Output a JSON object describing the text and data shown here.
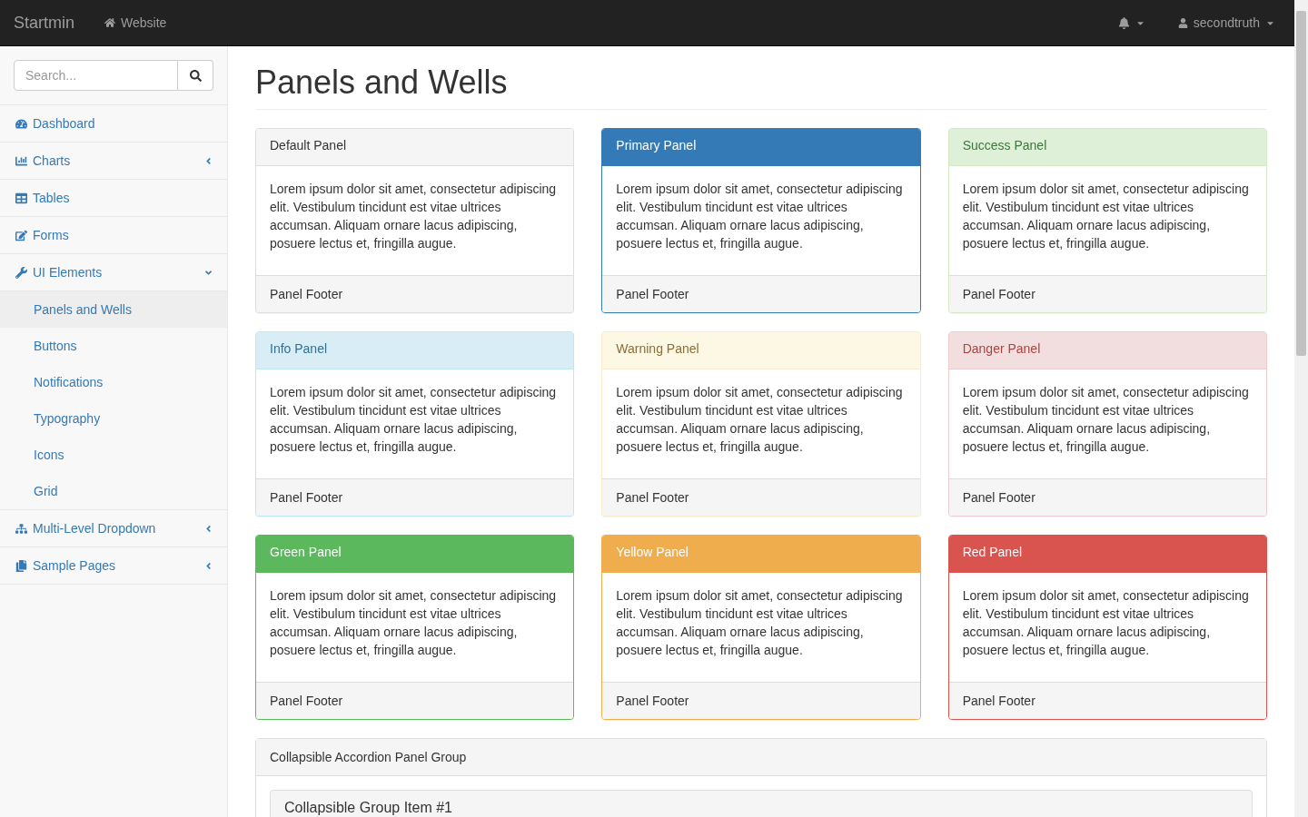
{
  "navbar": {
    "brand": "Startmin",
    "links": [
      {
        "label": "Website"
      }
    ],
    "user": "secondtruth"
  },
  "sidebar": {
    "search": {
      "placeholder": "Search..."
    },
    "items": [
      {
        "label": "Dashboard"
      },
      {
        "label": "Charts",
        "expanded": false
      },
      {
        "label": "Tables"
      },
      {
        "label": "Forms"
      },
      {
        "label": "UI Elements",
        "expanded": true,
        "children": [
          {
            "label": "Panels and Wells",
            "selected": true
          },
          {
            "label": "Buttons",
            "selected": false
          },
          {
            "label": "Notifications",
            "selected": false
          },
          {
            "label": "Typography",
            "selected": false
          },
          {
            "label": "Icons",
            "selected": false
          },
          {
            "label": "Grid",
            "selected": false
          }
        ]
      },
      {
        "label": "Multi-Level Dropdown",
        "expanded": false
      },
      {
        "label": "Sample Pages",
        "expanded": false
      }
    ]
  },
  "page": {
    "title": "Panels and Wells",
    "panels": [
      {
        "kind": "default",
        "heading": "Default Panel",
        "body": "Lorem ipsum dolor sit amet, consectetur adipiscing elit. Vestibulum tincidunt est vitae ultrices accumsan. Aliquam ornare lacus adipiscing, posuere lectus et, fringilla augue.",
        "footer": "Panel Footer"
      },
      {
        "kind": "primary",
        "heading": "Primary Panel",
        "body": "Lorem ipsum dolor sit amet, consectetur adipiscing elit. Vestibulum tincidunt est vitae ultrices accumsan. Aliquam ornare lacus adipiscing, posuere lectus et, fringilla augue.",
        "footer": "Panel Footer"
      },
      {
        "kind": "success",
        "heading": "Success Panel",
        "body": "Lorem ipsum dolor sit amet, consectetur adipiscing elit. Vestibulum tincidunt est vitae ultrices accumsan. Aliquam ornare lacus adipiscing, posuere lectus et, fringilla augue.",
        "footer": "Panel Footer"
      },
      {
        "kind": "info",
        "heading": "Info Panel",
        "body": "Lorem ipsum dolor sit amet, consectetur adipiscing elit. Vestibulum tincidunt est vitae ultrices accumsan. Aliquam ornare lacus adipiscing, posuere lectus et, fringilla augue.",
        "footer": "Panel Footer"
      },
      {
        "kind": "warning",
        "heading": "Warning Panel",
        "body": "Lorem ipsum dolor sit amet, consectetur adipiscing elit. Vestibulum tincidunt est vitae ultrices accumsan. Aliquam ornare lacus adipiscing, posuere lectus et, fringilla augue.",
        "footer": "Panel Footer"
      },
      {
        "kind": "danger",
        "heading": "Danger Panel",
        "body": "Lorem ipsum dolor sit amet, consectetur adipiscing elit. Vestibulum tincidunt est vitae ultrices accumsan. Aliquam ornare lacus adipiscing, posuere lectus et, fringilla augue.",
        "footer": "Panel Footer"
      },
      {
        "kind": "green",
        "heading": "Green Panel",
        "body": "Lorem ipsum dolor sit amet, consectetur adipiscing elit. Vestibulum tincidunt est vitae ultrices accumsan. Aliquam ornare lacus adipiscing, posuere lectus et, fringilla augue.",
        "footer": "Panel Footer"
      },
      {
        "kind": "yellow",
        "heading": "Yellow Panel",
        "body": "Lorem ipsum dolor sit amet, consectetur adipiscing elit. Vestibulum tincidunt est vitae ultrices accumsan. Aliquam ornare lacus adipiscing, posuere lectus et, fringilla augue.",
        "footer": "Panel Footer"
      },
      {
        "kind": "red",
        "heading": "Red Panel",
        "body": "Lorem ipsum dolor sit amet, consectetur adipiscing elit. Vestibulum tincidunt est vitae ultrices accumsan. Aliquam ornare lacus adipiscing, posuere lectus et, fringilla augue.",
        "footer": "Panel Footer"
      }
    ],
    "accordion": {
      "heading": "Collapsible Accordion Panel Group",
      "items": [
        {
          "title": "Collapsible Group Item #1"
        }
      ]
    }
  }
}
